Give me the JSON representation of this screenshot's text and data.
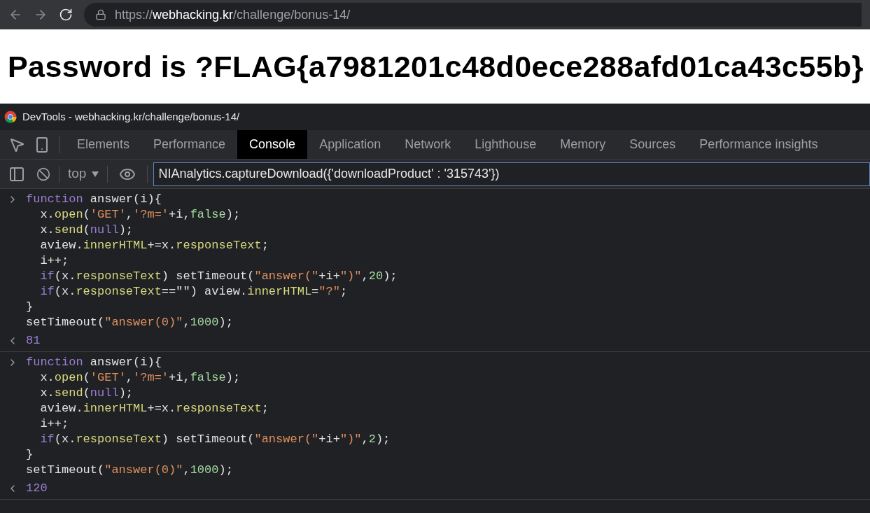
{
  "browser": {
    "url": {
      "scheme": "https://",
      "host": "webhacking.kr",
      "path": "/challenge/bonus-14/"
    }
  },
  "page": {
    "heading": "Password is ?FLAG{a7981201c48d0ece288afd01ca43c55b}"
  },
  "devtools": {
    "title": "DevTools - webhacking.kr/challenge/bonus-14/",
    "tabs": [
      {
        "label": "Elements",
        "selected": false
      },
      {
        "label": "Performance",
        "selected": false
      },
      {
        "label": "Console",
        "selected": true
      },
      {
        "label": "Application",
        "selected": false
      },
      {
        "label": "Network",
        "selected": false
      },
      {
        "label": "Lighthouse",
        "selected": false
      },
      {
        "label": "Memory",
        "selected": false
      },
      {
        "label": "Sources",
        "selected": false
      },
      {
        "label": "Performance insights",
        "selected": false
      }
    ],
    "context": "top",
    "filter": {
      "value": "NIAnalytics.captureDownload({'downloadProduct' : '315743'})"
    },
    "entries": [
      {
        "input": [
          [
            {
              "kind": "keyword",
              "text": "function"
            },
            {
              "kind": "plain",
              "text": " answer(i){"
            }
          ],
          [
            {
              "kind": "plain",
              "text": "  x."
            },
            {
              "kind": "method",
              "text": "open"
            },
            {
              "kind": "plain",
              "text": "("
            },
            {
              "kind": "string",
              "text": "'GET'"
            },
            {
              "kind": "plain",
              "text": ","
            },
            {
              "kind": "string",
              "text": "'?m='"
            },
            {
              "kind": "plain",
              "text": "+i,"
            },
            {
              "kind": "literal",
              "text": "false"
            },
            {
              "kind": "plain",
              "text": ");"
            }
          ],
          [
            {
              "kind": "plain",
              "text": "  x."
            },
            {
              "kind": "method",
              "text": "send"
            },
            {
              "kind": "plain",
              "text": "("
            },
            {
              "kind": "keyword",
              "text": "null"
            },
            {
              "kind": "plain",
              "text": ");"
            }
          ],
          [
            {
              "kind": "plain",
              "text": "  aview."
            },
            {
              "kind": "method",
              "text": "innerHTML"
            },
            {
              "kind": "plain",
              "text": "+=x."
            },
            {
              "kind": "method",
              "text": "responseText"
            },
            {
              "kind": "plain",
              "text": ";"
            }
          ],
          [
            {
              "kind": "plain",
              "text": "  i++;"
            }
          ],
          [
            {
              "kind": "keyword",
              "text": "  if"
            },
            {
              "kind": "plain",
              "text": "(x."
            },
            {
              "kind": "method",
              "text": "responseText"
            },
            {
              "kind": "plain",
              "text": ") setTimeout("
            },
            {
              "kind": "string",
              "text": "\"answer(\""
            },
            {
              "kind": "plain",
              "text": "+i+"
            },
            {
              "kind": "string",
              "text": "\")\""
            },
            {
              "kind": "plain",
              "text": ","
            },
            {
              "kind": "literal",
              "text": "20"
            },
            {
              "kind": "plain",
              "text": ");"
            }
          ],
          [
            {
              "kind": "keyword",
              "text": "  if"
            },
            {
              "kind": "plain",
              "text": "(x."
            },
            {
              "kind": "method",
              "text": "responseText"
            },
            {
              "kind": "plain",
              "text": "==\"\") aview."
            },
            {
              "kind": "method",
              "text": "innerHTML"
            },
            {
              "kind": "plain",
              "text": "="
            },
            {
              "kind": "string",
              "text": "\"?\""
            },
            {
              "kind": "plain",
              "text": ";"
            }
          ],
          [
            {
              "kind": "plain",
              "text": "}"
            }
          ],
          [
            {
              "kind": "plain",
              "text": "setTimeout("
            },
            {
              "kind": "string",
              "text": "\"answer(0)\""
            },
            {
              "kind": "plain",
              "text": ","
            },
            {
              "kind": "literal",
              "text": "1000"
            },
            {
              "kind": "plain",
              "text": ");"
            }
          ]
        ],
        "result": "81"
      },
      {
        "input": [
          [
            {
              "kind": "keyword",
              "text": "function"
            },
            {
              "kind": "plain",
              "text": " answer(i){"
            }
          ],
          [
            {
              "kind": "plain",
              "text": "  x."
            },
            {
              "kind": "method",
              "text": "open"
            },
            {
              "kind": "plain",
              "text": "("
            },
            {
              "kind": "string",
              "text": "'GET'"
            },
            {
              "kind": "plain",
              "text": ","
            },
            {
              "kind": "string",
              "text": "'?m='"
            },
            {
              "kind": "plain",
              "text": "+i,"
            },
            {
              "kind": "literal",
              "text": "false"
            },
            {
              "kind": "plain",
              "text": ");"
            }
          ],
          [
            {
              "kind": "plain",
              "text": "  x."
            },
            {
              "kind": "method",
              "text": "send"
            },
            {
              "kind": "plain",
              "text": "("
            },
            {
              "kind": "keyword",
              "text": "null"
            },
            {
              "kind": "plain",
              "text": ");"
            }
          ],
          [
            {
              "kind": "plain",
              "text": "  aview."
            },
            {
              "kind": "method",
              "text": "innerHTML"
            },
            {
              "kind": "plain",
              "text": "+=x."
            },
            {
              "kind": "method",
              "text": "responseText"
            },
            {
              "kind": "plain",
              "text": ";"
            }
          ],
          [
            {
              "kind": "plain",
              "text": "  i++;"
            }
          ],
          [
            {
              "kind": "keyword",
              "text": "  if"
            },
            {
              "kind": "plain",
              "text": "(x."
            },
            {
              "kind": "method",
              "text": "responseText"
            },
            {
              "kind": "plain",
              "text": ") setTimeout("
            },
            {
              "kind": "string",
              "text": "\"answer(\""
            },
            {
              "kind": "plain",
              "text": "+i+"
            },
            {
              "kind": "string",
              "text": "\")\""
            },
            {
              "kind": "plain",
              "text": ","
            },
            {
              "kind": "literal",
              "text": "2"
            },
            {
              "kind": "plain",
              "text": ");"
            }
          ],
          [
            {
              "kind": "plain",
              "text": "}"
            }
          ],
          [
            {
              "kind": "plain",
              "text": "setTimeout("
            },
            {
              "kind": "string",
              "text": "\"answer(0)\""
            },
            {
              "kind": "plain",
              "text": ","
            },
            {
              "kind": "literal",
              "text": "1000"
            },
            {
              "kind": "plain",
              "text": ");"
            }
          ]
        ],
        "result": "120"
      }
    ]
  }
}
